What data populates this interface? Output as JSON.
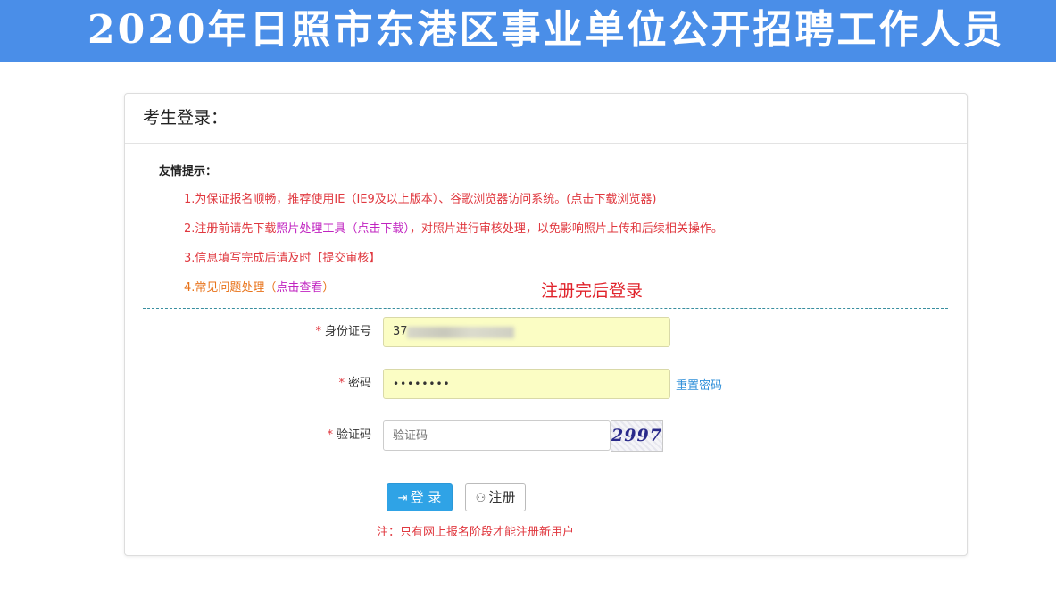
{
  "banner": {
    "title": "2020年日照市东港区事业单位公开招聘工作人员"
  },
  "panel": {
    "title": "考生登录："
  },
  "tips": {
    "title": "友情提示：",
    "tip1": {
      "prefix": "1.为保证报名顺畅，推荐使用IE（IE9及以上版本）、谷歌浏览器访问系统。(点击下载浏览器)"
    },
    "tip2": {
      "prefix": "2.注册前请先下载",
      "link": "照片处理工具（点击下载）",
      "suffix": "，对照片进行审核处理，以免影响照片上传和后续相关操作。"
    },
    "tip3": {
      "text": "3.信息填写完成后请及时【提交审核】"
    },
    "tip4": {
      "prefix": "4.常见问题处理（",
      "link": "点击查看",
      "suffix": "）"
    }
  },
  "annotation": "注册完后登录",
  "form": {
    "required_mark": "*",
    "id_label": "身份证号",
    "id_value_visible": "37",
    "password_label": "密码",
    "password_dots": "••••••••",
    "reset_password": "重置密码",
    "captcha_label": "验证码",
    "captcha_placeholder": "验证码",
    "captcha_image_text": "2997"
  },
  "buttons": {
    "login_icon": "⇥",
    "login_label": "登 录",
    "register_icon": "⚇",
    "register_label": "注册"
  },
  "note": "注：只有网上报名阶段才能注册新用户",
  "colors": {
    "banner": "#4a8ee8",
    "primary_button": "#2fa3e6",
    "warning_red": "#e0383f",
    "link_blue": "#2f8fd9"
  }
}
